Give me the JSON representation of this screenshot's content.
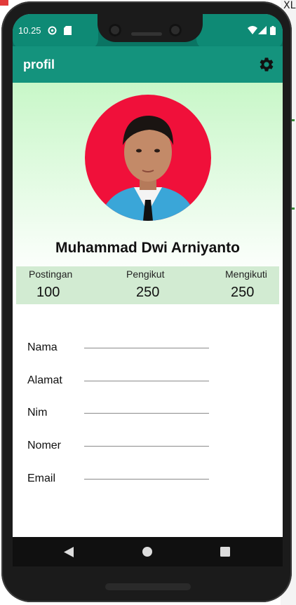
{
  "status_bar": {
    "time": "10.25"
  },
  "app_bar": {
    "title": "profil",
    "settings_icon": "gear-icon"
  },
  "profile": {
    "name": "Muhammad Dwi Arniyanto"
  },
  "stats": [
    {
      "label": "Postingan",
      "value": "100"
    },
    {
      "label": "Pengikut",
      "value": "250"
    },
    {
      "label": "Mengikuti",
      "value": "250"
    }
  ],
  "form": {
    "fields": [
      "Nama",
      "Alamat",
      "Nim",
      "Nomer",
      "Email"
    ]
  },
  "ide_background": {
    "label": "XL"
  },
  "colors": {
    "status_bar": "#0a7463",
    "app_bar": "#14937d",
    "stats_bg": "#d2ebd2",
    "hero_top": "#c8f7c8",
    "avatar_bg": "#f0103a"
  }
}
